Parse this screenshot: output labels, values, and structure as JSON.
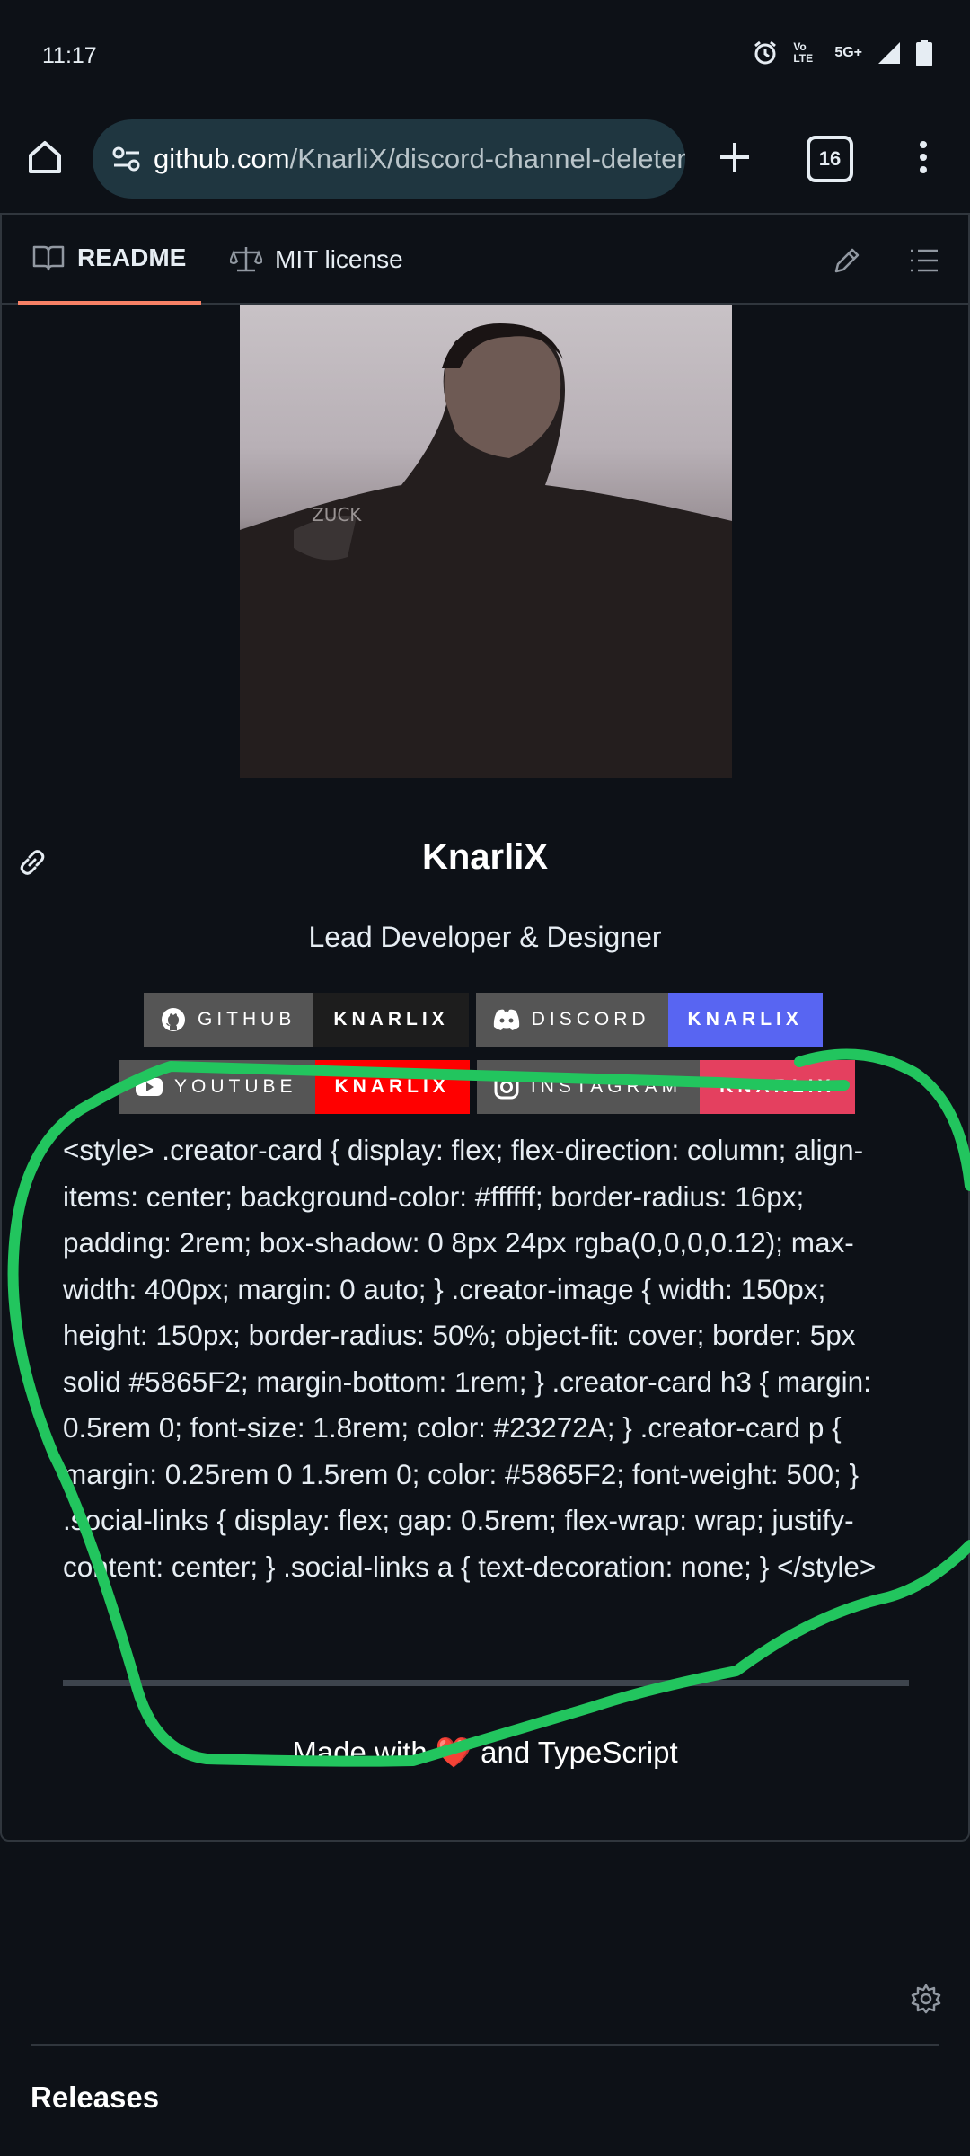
{
  "status_bar": {
    "time": "11:17",
    "network_label": "5G+",
    "volte_label": "Vo LTE"
  },
  "browser": {
    "url_domain": "github.com",
    "url_path": "/KnarliX/discord-channel-deleter",
    "tab_count": "16"
  },
  "readme_tabs": {
    "readme_label": "README",
    "license_label": "MIT license"
  },
  "creator": {
    "name": "KnarliX",
    "role": "Lead Developer & Designer"
  },
  "badges": [
    {
      "left": "GITHUB",
      "right": "KNARLIX",
      "right_color": "#1d1d1d",
      "icon": "github-icon"
    },
    {
      "left": "DISCORD",
      "right": "KNARLIX",
      "right_color": "#5865F2",
      "icon": "discord-icon"
    },
    {
      "left": "YOUTUBE",
      "right": "KNARLIX",
      "right_color": "#ff0000",
      "icon": "youtube-icon"
    },
    {
      "left": "INSTAGRAM",
      "right": "KNARLIX",
      "right_color": "#E4405F",
      "icon": "instagram-icon"
    }
  ],
  "style_block": "<style> .creator-card { display: flex; flex-direction: column; align-items: center; background-color: #ffffff; border-radius: 16px; padding: 2rem; box-shadow: 0 8px 24px rgba(0,0,0,0.12); max-width: 400px; margin: 0 auto; } .creator-image { width: 150px; height: 150px; border-radius: 50%; object-fit: cover; border: 5px solid #5865F2; margin-bottom: 1rem; } .creator-card h3 { margin: 0.5rem 0; font-size: 1.8rem; color: #23272A; } .creator-card p { margin: 0.25rem 0 1.5rem 0; color: #5865F2; font-weight: 500; } .social-links { display: flex; gap: 0.5rem; flex-wrap: wrap; justify-content: center; } .social-links a { text-decoration: none; } </style>",
  "footer": {
    "made_with": "Made with",
    "heart": "❤️",
    "and_ts": "and TypeScript"
  },
  "releases": {
    "heading": "Releases"
  },
  "colors": {
    "background": "#0d1117",
    "url_pill": "#1f3640",
    "tab_underline": "#f78166",
    "scribble": "#22c55e"
  }
}
